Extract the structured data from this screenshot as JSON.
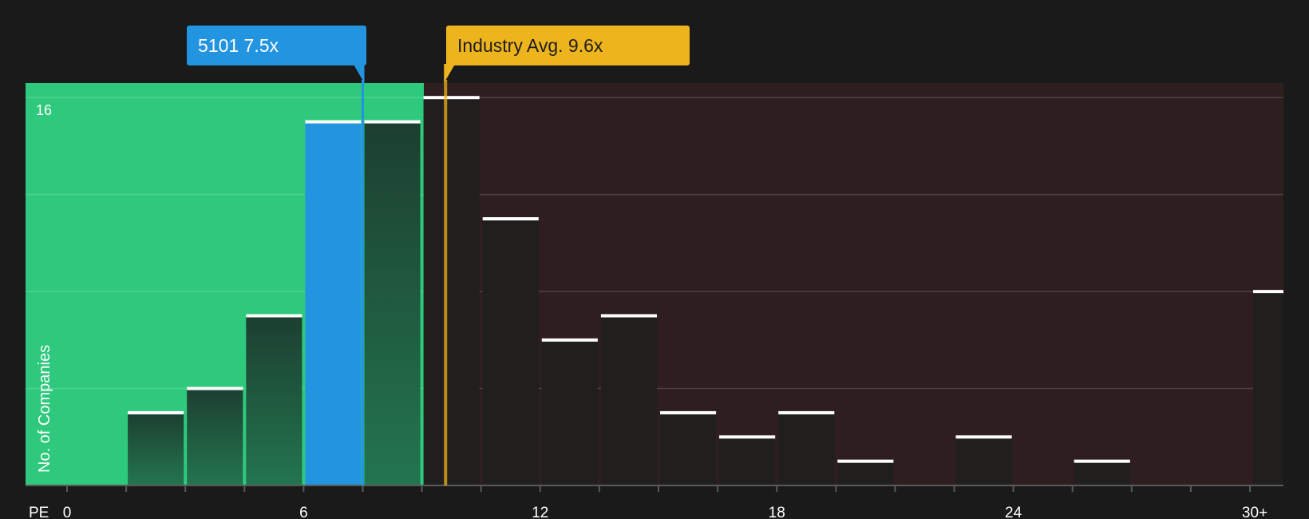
{
  "chart_data": {
    "type": "bar",
    "xlabel": "PE",
    "ylabel": "No. of Companies",
    "x_ticks": [
      "0",
      "6",
      "12",
      "18",
      "24",
      "30+"
    ],
    "y_ticks": [
      "16"
    ],
    "ylim": [
      0,
      16.6
    ],
    "bins": [
      {
        "x0": 0,
        "x1": 1.5,
        "value": 0
      },
      {
        "x0": 1.5,
        "x1": 3.0,
        "value": 3
      },
      {
        "x0": 3.0,
        "x1": 4.5,
        "value": 4
      },
      {
        "x0": 4.5,
        "x1": 6.0,
        "value": 7
      },
      {
        "x0": 6.0,
        "x1": 7.5,
        "value": 15,
        "highlight": true
      },
      {
        "x0": 7.5,
        "x1": 9.0,
        "value": 15
      },
      {
        "x0": 9.0,
        "x1": 10.5,
        "value": 16
      },
      {
        "x0": 10.5,
        "x1": 12.0,
        "value": 11
      },
      {
        "x0": 12.0,
        "x1": 13.5,
        "value": 6
      },
      {
        "x0": 13.5,
        "x1": 15.0,
        "value": 7
      },
      {
        "x0": 15.0,
        "x1": 16.5,
        "value": 3
      },
      {
        "x0": 16.5,
        "x1": 18.0,
        "value": 2
      },
      {
        "x0": 18.0,
        "x1": 19.5,
        "value": 3
      },
      {
        "x0": 19.5,
        "x1": 21.0,
        "value": 1
      },
      {
        "x0": 21.0,
        "x1": 22.5,
        "value": 0
      },
      {
        "x0": 22.5,
        "x1": 24.0,
        "value": 2
      },
      {
        "x0": 24.0,
        "x1": 25.5,
        "value": 0
      },
      {
        "x0": 25.5,
        "x1": 27.0,
        "value": 1
      },
      {
        "x0": 27.0,
        "x1": 28.5,
        "value": 0
      },
      {
        "x0": 28.5,
        "x1": 30.0,
        "value": 0
      },
      {
        "x0": 30.0,
        "x1": 31.5,
        "value": 8
      }
    ],
    "company": {
      "label": "5101 7.5x",
      "value": 7.5
    },
    "industry": {
      "label": "Industry Avg. 9.6x",
      "value": 9.6
    },
    "grid": true,
    "colors": {
      "background": "#1a1a1a",
      "undervalued_zone": "#2ec97d",
      "overvalued_zone": "#2e1e1f",
      "company_bar": "#2394e0",
      "industry_marker": "#eeb41d",
      "bar_in_green": "#1e4d37",
      "bar_in_red": "#211e1e"
    }
  }
}
